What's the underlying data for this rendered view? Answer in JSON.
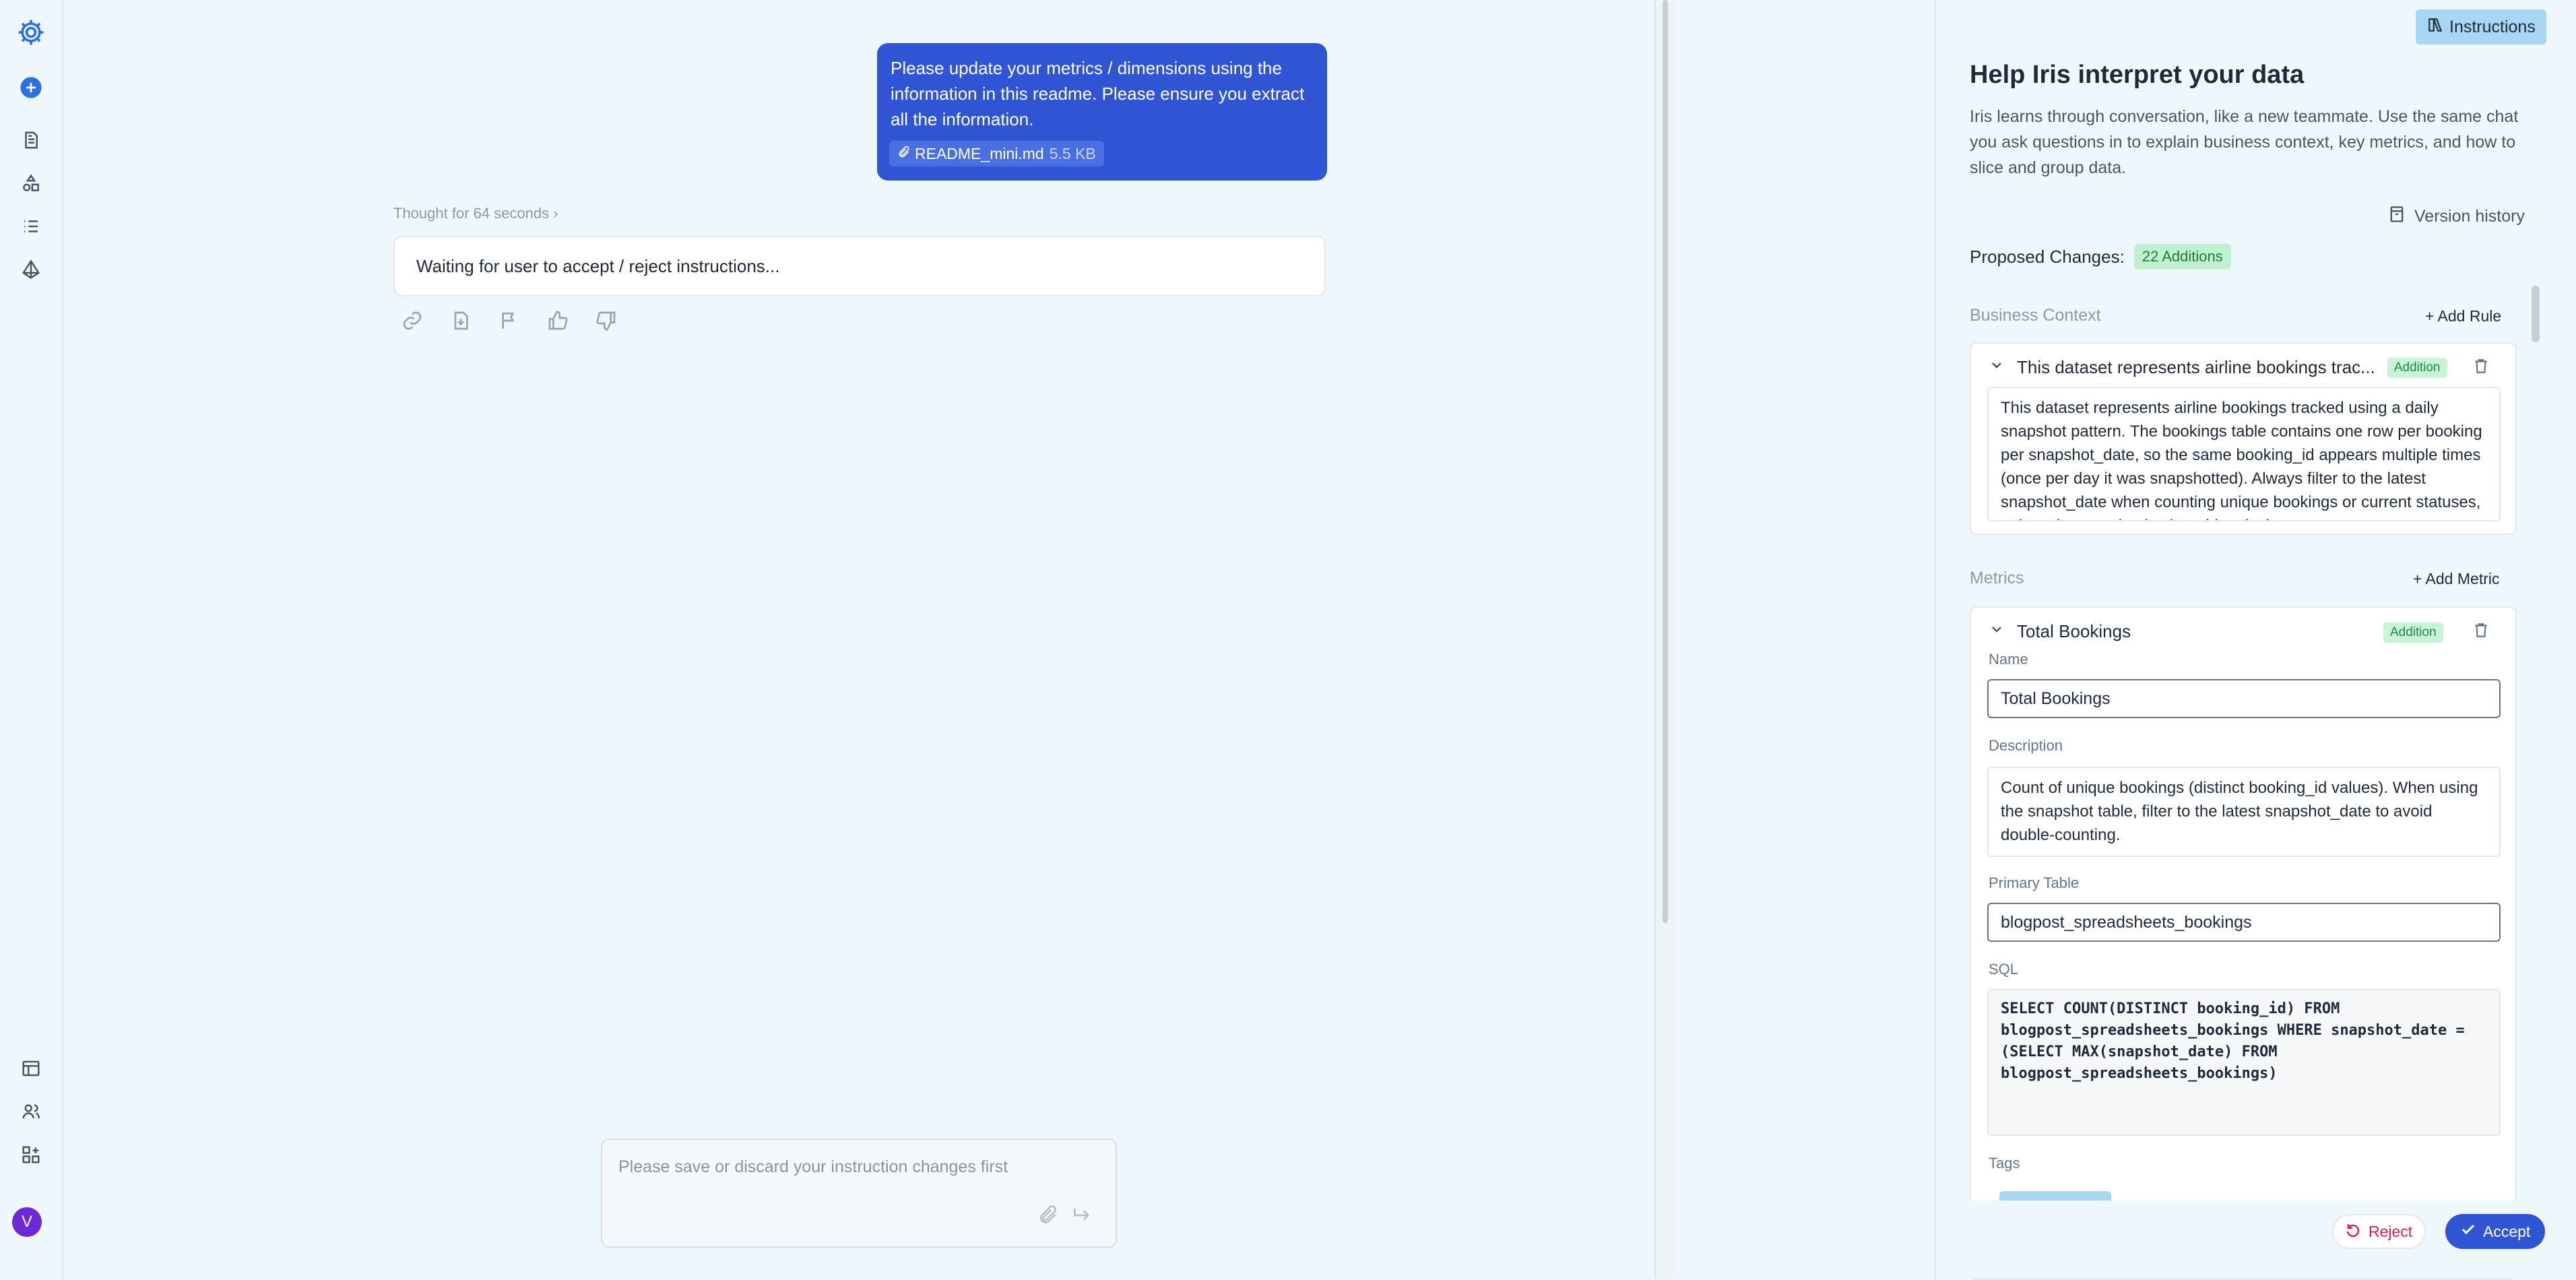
{
  "chat": {
    "user_message": "Please update your metrics / dimensions using the information in this readme. Please ensure you extract all the information.",
    "attachment": {
      "name": "README_mini.md",
      "size": "5.5 KB"
    },
    "thought_label": "Thought for 64 seconds",
    "assistant_message": "Waiting for user to accept / reject instructions...",
    "composer_placeholder": "Please save or discard your instruction changes first"
  },
  "avatar_initial": "V",
  "panel": {
    "instructions_button": "Instructions",
    "title": "Help Iris interpret your data",
    "subtitle": "Iris learns through conversation, like a new teammate. Use the same chat you ask questions in to explain business context, key metrics, and how to slice and group data.",
    "version_history": "Version history",
    "proposed_label": "Proposed Changes:",
    "proposed_badge": "22 Additions",
    "business_context": {
      "heading": "Business Context",
      "add_label": "+ Add Rule",
      "card_title": "This dataset represents airline bookings trac...",
      "badge": "Addition",
      "body": "This dataset represents airline bookings tracked using a daily snapshot pattern. The bookings table contains one row per booking per snapshot_date, so the same booking_id appears multiple times (once per day it was snapshotted). Always filter to the latest snapshot_date when counting unique bookings or current statuses, unless the question is about historical"
    },
    "metrics": {
      "heading": "Metrics",
      "add_label": "+ Add Metric",
      "card_title": "Total Bookings",
      "badge": "Addition",
      "name_label": "Name",
      "name_value": "Total Bookings",
      "description_label": "Description",
      "description_value": "Count of unique bookings (distinct booking_id values). When using the snapshot table, filter to the latest snapshot_date to avoid double-counting.",
      "primary_table_label": "Primary Table",
      "primary_table_value": "blogpost_spreadsheets_bookings",
      "sql_label": "SQL",
      "sql_value": "SELECT COUNT(DISTINCT booking_id) FROM blogpost_spreadsheets_bookings WHERE snapshot_date = (SELECT MAX(snapshot_date) FROM blogpost_spreadsheets_bookings)",
      "tags_label": "Tags"
    },
    "reject_label": "Reject",
    "accept_label": "Accept"
  },
  "colors": {
    "background": "#eef7fc",
    "accent": "#2f55d4",
    "addition_badge": "#c9f3d6",
    "reject": "#e11d48"
  }
}
